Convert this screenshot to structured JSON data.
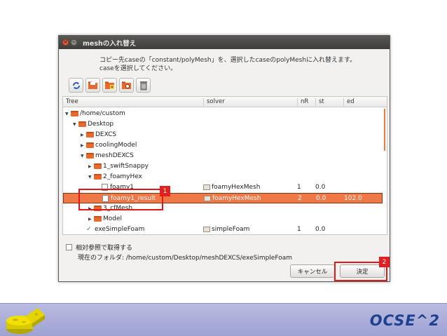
{
  "dialog": {
    "title": "meshの入れ替え",
    "description_line1": "コピー先caseの「constant/polyMesh」を、選択したcaseのpolyMeshに入れ替えます。",
    "description_line2": "caseを選択してください。",
    "toolbar": [
      {
        "icon": "refresh-icon"
      },
      {
        "icon": "open-folder-icon"
      },
      {
        "icon": "new-folder-icon"
      },
      {
        "icon": "folder-settings-icon"
      },
      {
        "icon": "trash-icon"
      }
    ],
    "columns": {
      "tree": "Tree",
      "solver": "solver",
      "nR": "nR",
      "st": "st",
      "ed": "ed"
    },
    "rows": [
      {
        "label": "/home/custom",
        "depth": 0,
        "type": "folder",
        "expanded": true
      },
      {
        "label": "Desktop",
        "depth": 1,
        "type": "folder",
        "expanded": true
      },
      {
        "label": "DEXCS",
        "depth": 2,
        "type": "folder",
        "expanded": false
      },
      {
        "label": "coolingModel",
        "depth": 2,
        "type": "folder",
        "expanded": false
      },
      {
        "label": "meshDEXCS",
        "depth": 2,
        "type": "folder",
        "expanded": true
      },
      {
        "label": "1_swiftSnappy",
        "depth": 3,
        "type": "folder",
        "expanded": false
      },
      {
        "label": "2_foamyHex",
        "depth": 3,
        "type": "folder",
        "expanded": true
      },
      {
        "label": "foamy1",
        "depth": 4,
        "type": "file",
        "solver": "foamyHexMesh",
        "nR": "1",
        "st": "0.0",
        "ed": ""
      },
      {
        "label": "foamy1_result",
        "depth": 4,
        "type": "file",
        "solver": "foamyHexMesh",
        "nR": "2",
        "st": "0.0",
        "ed": "102.0",
        "selected": true
      },
      {
        "label": "3_cfMesh",
        "depth": 3,
        "type": "folder",
        "expanded": false
      },
      {
        "label": "Model",
        "depth": 3,
        "type": "folder",
        "expanded": false
      },
      {
        "label": "exeSimpleFoam",
        "depth": 2,
        "type": "exe",
        "solver": "simpleFoam",
        "nR": "1",
        "st": "0.0",
        "ed": ""
      }
    ],
    "checkbox_label": "相対参照で取得する",
    "current_folder": "現在のフォルダ: /home/custom/Desktop/meshDEXCS/exeSimpleFoam",
    "cancel_label": "キャンセル",
    "ok_label": "決定"
  },
  "annotations": [
    {
      "number": "1"
    },
    {
      "number": "2"
    }
  ],
  "footer": {
    "brand": "OCSE^2"
  },
  "colors": {
    "selection": "#f07746",
    "annotation": "#e01818",
    "titlebar": "#3d3c38",
    "band": "#a9acd8"
  }
}
